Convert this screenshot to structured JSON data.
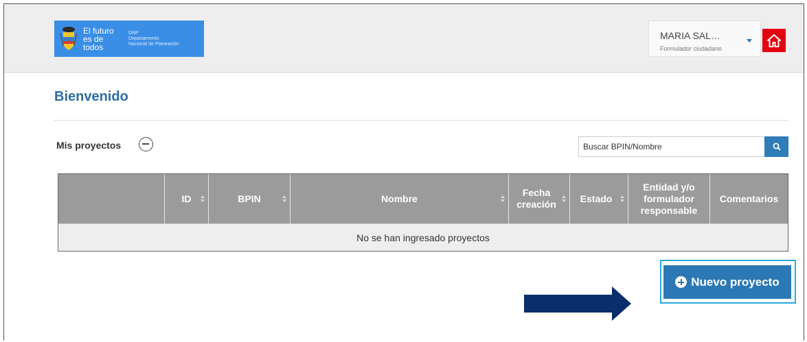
{
  "header": {
    "logo": {
      "line1": "El futuro",
      "line2": "es de todos",
      "org_abbr": "DNP",
      "org_line1": "Departamento",
      "org_line2": "Nacional de Planeación"
    },
    "user": {
      "name": "MARIA SAL…",
      "role": "Formulador ciudadano"
    },
    "home_icon": "home-icon"
  },
  "page": {
    "title": "Bienvenido"
  },
  "projects": {
    "section_label": "Mis proyectos",
    "search_placeholder": "Buscar BPIN/Nombre",
    "columns": [
      {
        "label": ""
      },
      {
        "label": "ID"
      },
      {
        "label": "BPIN"
      },
      {
        "label": "Nombre"
      },
      {
        "label": "Fecha creación"
      },
      {
        "label": "Estado"
      },
      {
        "label": "Entidad y/o formulador responsable"
      },
      {
        "label": "Comentarios"
      }
    ],
    "empty_message": "No se han ingresado proyectos",
    "new_button_label": "Nuevo proyecto"
  },
  "colors": {
    "accent": "#2b78b4",
    "title": "#2e6da4",
    "home_button": "#e3000f",
    "table_header": "#9b9b9b",
    "highlight": "#27a9e1",
    "arrow": "#0b2d6b"
  }
}
